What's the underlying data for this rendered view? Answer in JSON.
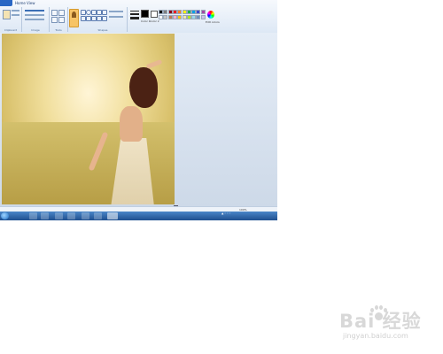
{
  "app": {
    "name": "Paint",
    "file_tab": "File",
    "tabs": [
      "Home",
      "View"
    ]
  },
  "ribbon": {
    "groups": [
      {
        "id": "clipboard",
        "label": "Clipboard"
      },
      {
        "id": "image",
        "label": "Image"
      },
      {
        "id": "tools",
        "label": "Tools"
      },
      {
        "id": "brushes",
        "label": "Brushes"
      },
      {
        "id": "shapes",
        "label": "Shapes"
      },
      {
        "id": "size",
        "label": "Size"
      },
      {
        "id": "colors",
        "label": "Colors"
      }
    ],
    "color1_label": "Color 1",
    "color2_label": "Color 2",
    "edit_colors_label": "Edit colors",
    "palette": [
      "#000000",
      "#7f7f7f",
      "#880015",
      "#ed1c24",
      "#ff7f27",
      "#fff200",
      "#22b14c",
      "#00a2e8",
      "#3f48cc",
      "#a349a4",
      "#ffffff",
      "#c3c3c3",
      "#b97a57",
      "#ffaec9",
      "#ffc90e",
      "#efe4b0",
      "#b5e61d",
      "#99d9ea",
      "#7092be",
      "#c8bfe7"
    ]
  },
  "status_bar": {
    "position": "",
    "selection": "",
    "size": "",
    "zoom": "100%"
  },
  "taskbar": {
    "apps": [
      "explorer",
      "media-player",
      "chrome",
      "ie",
      "paint",
      "qq",
      "folder",
      "paint-active"
    ],
    "clock_time": "",
    "clock_date": ""
  },
  "watermark": {
    "main": "Bai 经验",
    "sub": "jingyan.baidu.com"
  },
  "colors": {
    "ribbon": "#dde8f5",
    "taskbar": "#1f4f8f",
    "brush_active": "#f7c466"
  }
}
